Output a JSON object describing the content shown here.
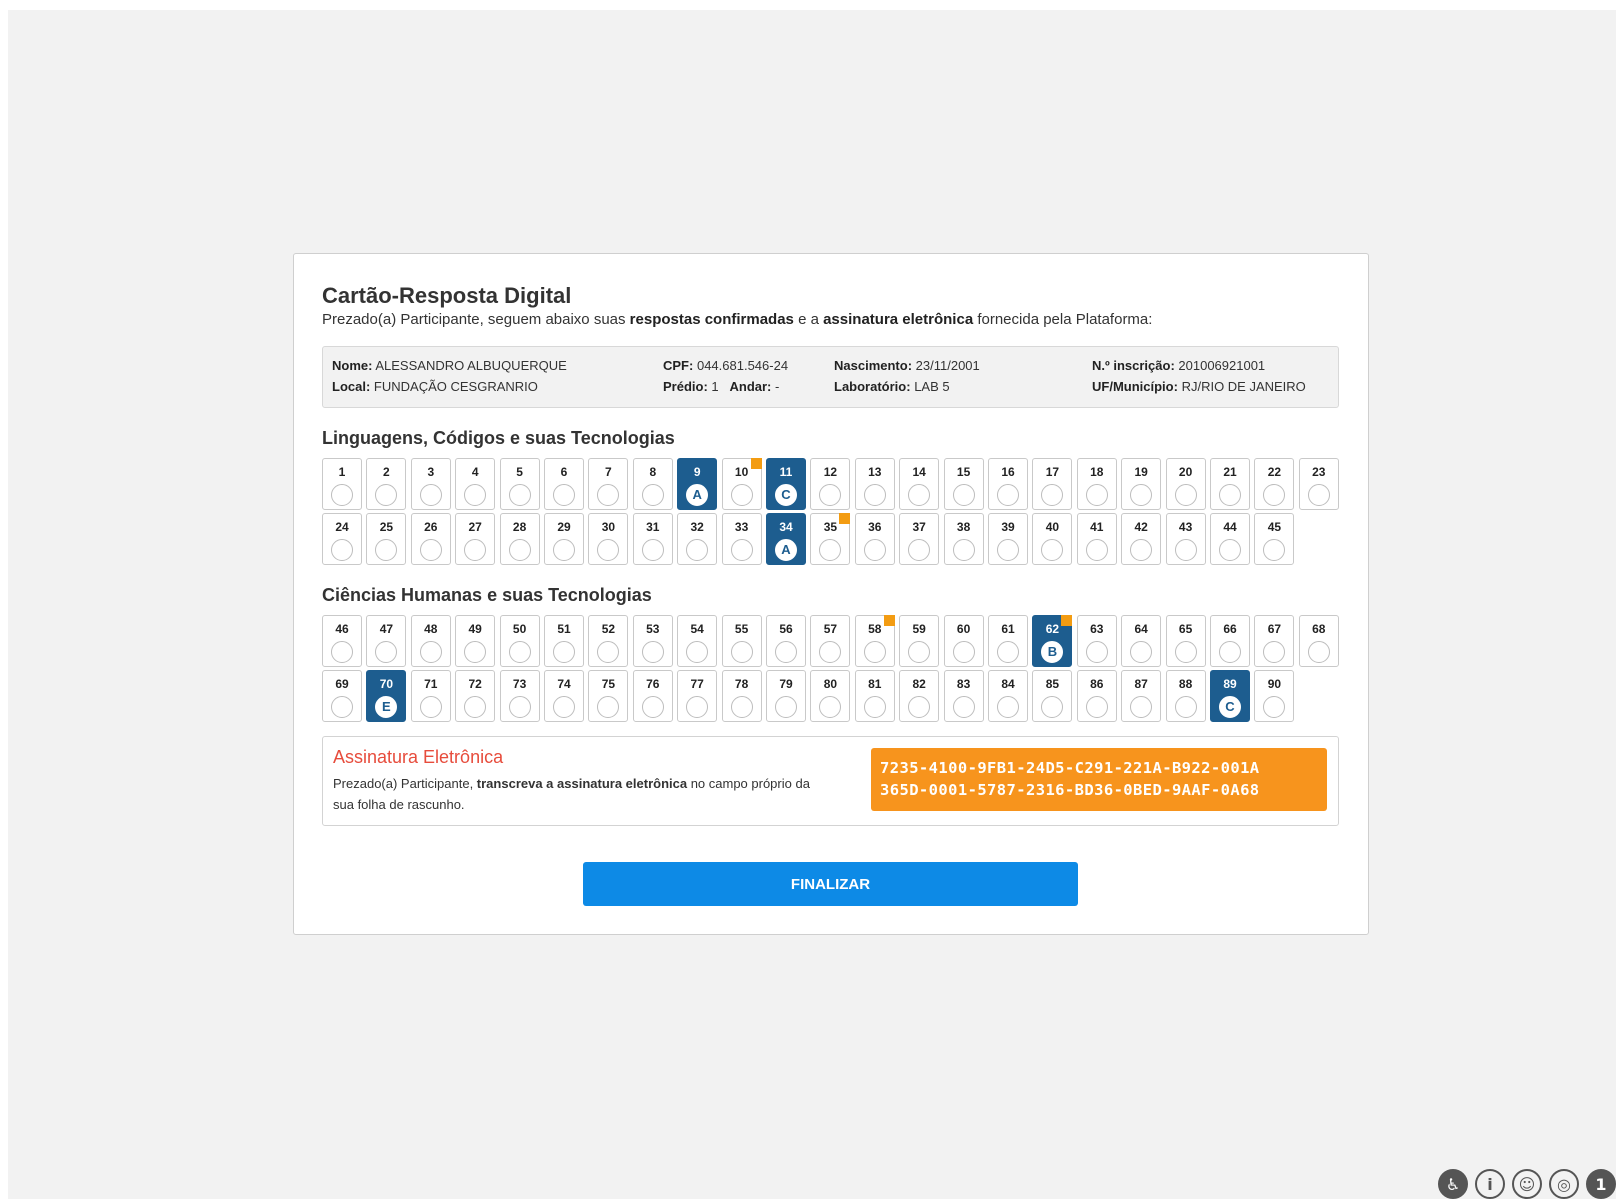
{
  "header": {
    "title": "Cartão-Resposta Digital",
    "subtitle_pre": "Prezado(a) Participante, seguem abaixo suas ",
    "subtitle_b1": "respostas confirmadas",
    "subtitle_mid": " e a ",
    "subtitle_b2": "assinatura eletrônica",
    "subtitle_post": " fornecida pela Plataforma:"
  },
  "participant": {
    "nome_label": "Nome:",
    "nome": "ALESSANDRO ALBUQUERQUE",
    "local_label": "Local:",
    "local": "FUNDAÇÃO CESGRANRIO",
    "cpf_label": "CPF:",
    "cpf": "044.681.546-24",
    "predio_label": "Prédio:",
    "predio": "1",
    "andar_label": "Andar:",
    "andar": "-",
    "nascimento_label": "Nascimento:",
    "nascimento": "23/11/2001",
    "laboratorio_label": "Laboratório:",
    "laboratorio": "LAB 5",
    "inscricao_label": "N.º inscrição:",
    "inscricao": "201006921001",
    "uf_label": "UF/Município:",
    "uf": "RJ/RIO DE JANEIRO"
  },
  "sections": [
    {
      "title": "Linguagens, Códigos e suas Tecnologias",
      "rows": [
        [
          {
            "n": "1",
            "a": ""
          },
          {
            "n": "2",
            "a": ""
          },
          {
            "n": "3",
            "a": ""
          },
          {
            "n": "4",
            "a": ""
          },
          {
            "n": "5",
            "a": ""
          },
          {
            "n": "6",
            "a": ""
          },
          {
            "n": "7",
            "a": ""
          },
          {
            "n": "8",
            "a": ""
          },
          {
            "n": "9",
            "a": "A"
          },
          {
            "n": "10",
            "a": "",
            "flag": true
          },
          {
            "n": "11",
            "a": "C"
          },
          {
            "n": "12",
            "a": ""
          },
          {
            "n": "13",
            "a": ""
          },
          {
            "n": "14",
            "a": ""
          },
          {
            "n": "15",
            "a": ""
          },
          {
            "n": "16",
            "a": ""
          },
          {
            "n": "17",
            "a": ""
          },
          {
            "n": "18",
            "a": ""
          },
          {
            "n": "19",
            "a": ""
          },
          {
            "n": "20",
            "a": ""
          },
          {
            "n": "21",
            "a": ""
          },
          {
            "n": "22",
            "a": ""
          },
          {
            "n": "23",
            "a": ""
          }
        ],
        [
          {
            "n": "24",
            "a": ""
          },
          {
            "n": "25",
            "a": ""
          },
          {
            "n": "26",
            "a": ""
          },
          {
            "n": "27",
            "a": ""
          },
          {
            "n": "28",
            "a": ""
          },
          {
            "n": "29",
            "a": ""
          },
          {
            "n": "30",
            "a": ""
          },
          {
            "n": "31",
            "a": ""
          },
          {
            "n": "32",
            "a": ""
          },
          {
            "n": "33",
            "a": ""
          },
          {
            "n": "34",
            "a": "A"
          },
          {
            "n": "35",
            "a": "",
            "flag": true
          },
          {
            "n": "36",
            "a": ""
          },
          {
            "n": "37",
            "a": ""
          },
          {
            "n": "38",
            "a": ""
          },
          {
            "n": "39",
            "a": ""
          },
          {
            "n": "40",
            "a": ""
          },
          {
            "n": "41",
            "a": ""
          },
          {
            "n": "42",
            "a": ""
          },
          {
            "n": "43",
            "a": ""
          },
          {
            "n": "44",
            "a": ""
          },
          {
            "n": "45",
            "a": ""
          }
        ]
      ]
    },
    {
      "title": "Ciências Humanas e suas Tecnologias",
      "rows": [
        [
          {
            "n": "46",
            "a": ""
          },
          {
            "n": "47",
            "a": ""
          },
          {
            "n": "48",
            "a": ""
          },
          {
            "n": "49",
            "a": ""
          },
          {
            "n": "50",
            "a": ""
          },
          {
            "n": "51",
            "a": ""
          },
          {
            "n": "52",
            "a": ""
          },
          {
            "n": "53",
            "a": ""
          },
          {
            "n": "54",
            "a": ""
          },
          {
            "n": "55",
            "a": ""
          },
          {
            "n": "56",
            "a": ""
          },
          {
            "n": "57",
            "a": ""
          },
          {
            "n": "58",
            "a": "",
            "flag": true
          },
          {
            "n": "59",
            "a": ""
          },
          {
            "n": "60",
            "a": ""
          },
          {
            "n": "61",
            "a": ""
          },
          {
            "n": "62",
            "a": "B",
            "flag": true
          },
          {
            "n": "63",
            "a": ""
          },
          {
            "n": "64",
            "a": ""
          },
          {
            "n": "65",
            "a": ""
          },
          {
            "n": "66",
            "a": ""
          },
          {
            "n": "67",
            "a": ""
          },
          {
            "n": "68",
            "a": ""
          }
        ],
        [
          {
            "n": "69",
            "a": ""
          },
          {
            "n": "70",
            "a": "E"
          },
          {
            "n": "71",
            "a": ""
          },
          {
            "n": "72",
            "a": ""
          },
          {
            "n": "73",
            "a": ""
          },
          {
            "n": "74",
            "a": ""
          },
          {
            "n": "75",
            "a": ""
          },
          {
            "n": "76",
            "a": ""
          },
          {
            "n": "77",
            "a": ""
          },
          {
            "n": "78",
            "a": ""
          },
          {
            "n": "79",
            "a": ""
          },
          {
            "n": "80",
            "a": ""
          },
          {
            "n": "81",
            "a": ""
          },
          {
            "n": "82",
            "a": ""
          },
          {
            "n": "83",
            "a": ""
          },
          {
            "n": "84",
            "a": ""
          },
          {
            "n": "85",
            "a": ""
          },
          {
            "n": "86",
            "a": ""
          },
          {
            "n": "87",
            "a": ""
          },
          {
            "n": "88",
            "a": ""
          },
          {
            "n": "89",
            "a": "C"
          },
          {
            "n": "90",
            "a": ""
          }
        ]
      ]
    }
  ],
  "signature": {
    "title": "Assinatura Eletrônica",
    "text_pre": "Prezado(a) Participante, ",
    "text_b": "transcreva a assinatura eletrônica",
    "text_post": " no campo próprio da sua folha de rascunho.",
    "code_line1": "7235-4100-9FB1-24D5-C291-221A-B922-001A",
    "code_line2": "365D-0001-5787-2316-BD36-0BED-9AAF-0A68"
  },
  "finalizar_label": "FINALIZAR",
  "footer_icons": [
    {
      "name": "accessibility-icon",
      "glyph": "♿"
    },
    {
      "name": "info-icon",
      "glyph": "i"
    },
    {
      "name": "accessible-person-icon",
      "glyph": "☺"
    },
    {
      "name": "target-icon",
      "glyph": "◎"
    },
    {
      "name": "notification-count-icon",
      "glyph": "1"
    }
  ],
  "colors": {
    "answered": "#1d5d8f",
    "flag": "#f39c12",
    "signature_bg": "#f7941d",
    "signature_title": "#e74c3c",
    "button": "#0d8ae6"
  }
}
